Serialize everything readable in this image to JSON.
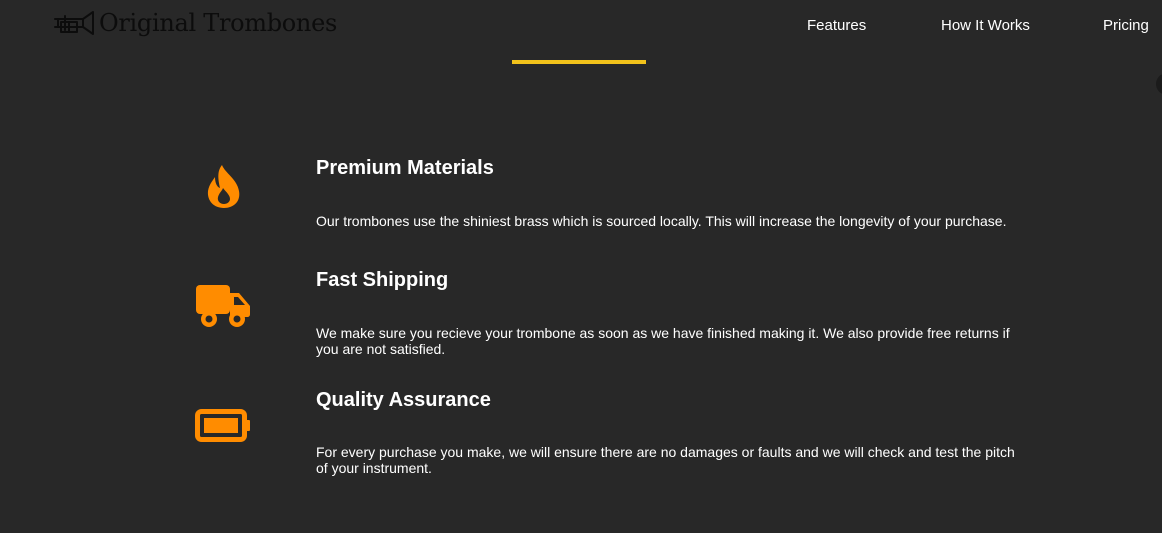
{
  "header": {
    "logo_text": "Original Trombones",
    "logo_icon": "trombone-icon",
    "nav": [
      {
        "label": "Features"
      },
      {
        "label": "How It Works"
      },
      {
        "label": "Pricing"
      }
    ]
  },
  "features": [
    {
      "icon": "fire-icon",
      "title": "Premium Materials",
      "description": "Our trombones use the shiniest brass which is sourced locally. This will increase the longevity of your purchase."
    },
    {
      "icon": "truck-icon",
      "title": "Fast Shipping",
      "description": "We make sure you recieve your trombone as soon as we have finished making it. We also provide free returns if you are not satisfied."
    },
    {
      "icon": "battery-icon",
      "title": "Quality Assurance",
      "description": "For every purchase you make, we will ensure there are no damages or faults and we will check and test the pitch of your instrument."
    }
  ],
  "colors": {
    "background": "#282828",
    "accent": "#f2c21b",
    "icon": "#ff8c00",
    "text": "#ffffff",
    "logo": "#0c0c0c"
  }
}
